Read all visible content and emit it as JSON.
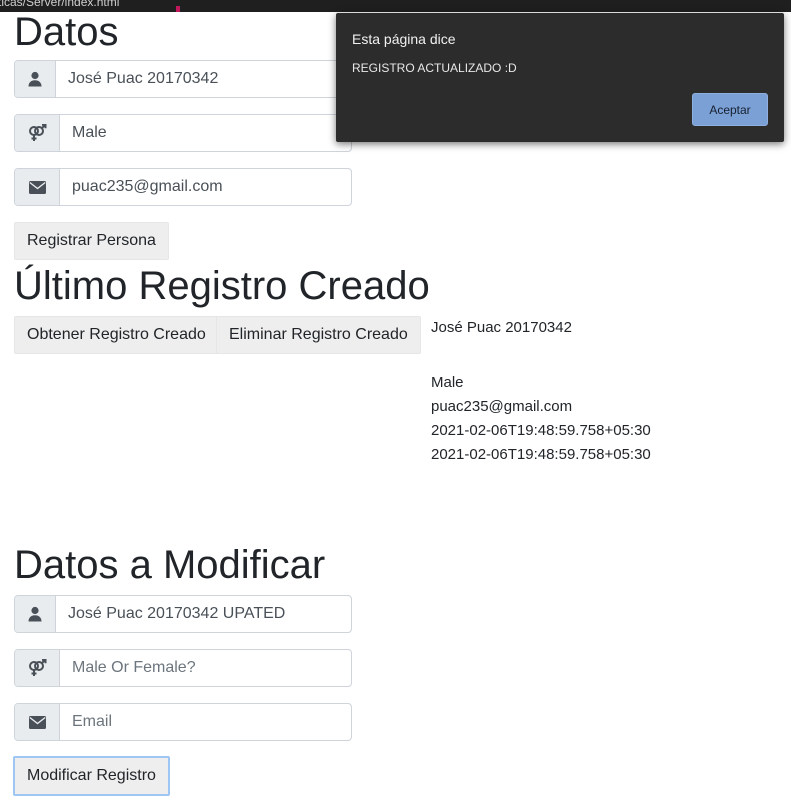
{
  "browser": {
    "url_fragment": "ticas/Server/index.html"
  },
  "create_section": {
    "title": "Datos",
    "name_value": "José Puac 20170342",
    "gender_value": "Male",
    "email_value": "puac235@gmail.com",
    "submit_label": "Registrar Persona"
  },
  "last_record_section": {
    "title": "Último Registro Creado",
    "get_button_label": "Obtener Registro Creado",
    "delete_button_label": "Eliminar Registro Creado",
    "record": {
      "name": "José Puac 20170342",
      "gender": "Male",
      "email": "puac235@gmail.com",
      "created_at": "2021-02-06T19:48:59.758+05:30",
      "updated_at": "2021-02-06T19:48:59.758+05:30"
    }
  },
  "modify_section": {
    "title": "Datos a Modificar",
    "name_value": "José Puac 20170342 UPATED",
    "gender_placeholder": "Male Or Female?",
    "email_placeholder": "Email",
    "submit_label": "Modificar Registro"
  },
  "alert_dialog": {
    "title": "Esta página dice",
    "message": "REGISTRO ACTUALIZADO :D",
    "accept_label": "Aceptar"
  },
  "icons": {
    "user": "user-icon",
    "gender": "venus-mars-icon",
    "email": "envelope-icon"
  },
  "colors": {
    "addon_background": "#e9ecef",
    "button_background": "#eeeeee",
    "dialog_background": "#2c2c2c",
    "dialog_button": "#7aa0d6"
  }
}
